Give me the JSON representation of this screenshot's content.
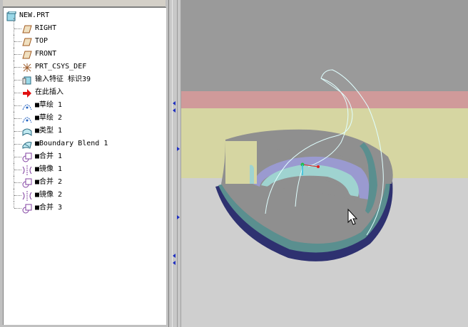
{
  "model_tree": {
    "root": {
      "label": "NEW.PRT",
      "icon": "part-icon"
    },
    "items": [
      {
        "label": "RIGHT",
        "icon": "datum-plane-icon"
      },
      {
        "label": "TOP",
        "icon": "datum-plane-icon"
      },
      {
        "label": "FRONT",
        "icon": "datum-plane-icon"
      },
      {
        "label": "PRT_CSYS_DEF",
        "icon": "coordinate-system-icon"
      },
      {
        "label": "输入特征 标识39",
        "icon": "import-feature-icon"
      },
      {
        "label": "在此插入",
        "icon": "insert-here-arrow-icon"
      },
      {
        "label": "■草绘 1",
        "icon": "sketch-icon"
      },
      {
        "label": "■草绘 2",
        "icon": "sketch-icon"
      },
      {
        "label": "■类型 1",
        "icon": "surface-icon"
      },
      {
        "label": "■Boundary Blend 1",
        "icon": "boundary-blend-icon"
      },
      {
        "label": "■合并 1",
        "icon": "merge-icon"
      },
      {
        "label": "■镜像 1",
        "icon": "mirror-icon"
      },
      {
        "label": "■合并 2",
        "icon": "merge-icon"
      },
      {
        "label": "■镜像 2",
        "icon": "mirror-icon"
      },
      {
        "label": "■合并 3",
        "icon": "merge-icon"
      }
    ]
  },
  "colors": {
    "viewport_top": "#9a9a9a",
    "band_pink": "#d09a9a",
    "band_yellow": "#d6d6a2",
    "viewport_bottom": "#cfcfcf",
    "shell_dark": "#2e3170",
    "shell_grey": "#8f8f8f",
    "shell_teal": "#5a8f8f",
    "shell_lavender": "#9a9ad0",
    "shell_light_teal": "#9fd3d0",
    "curve": "#e0ffff"
  }
}
